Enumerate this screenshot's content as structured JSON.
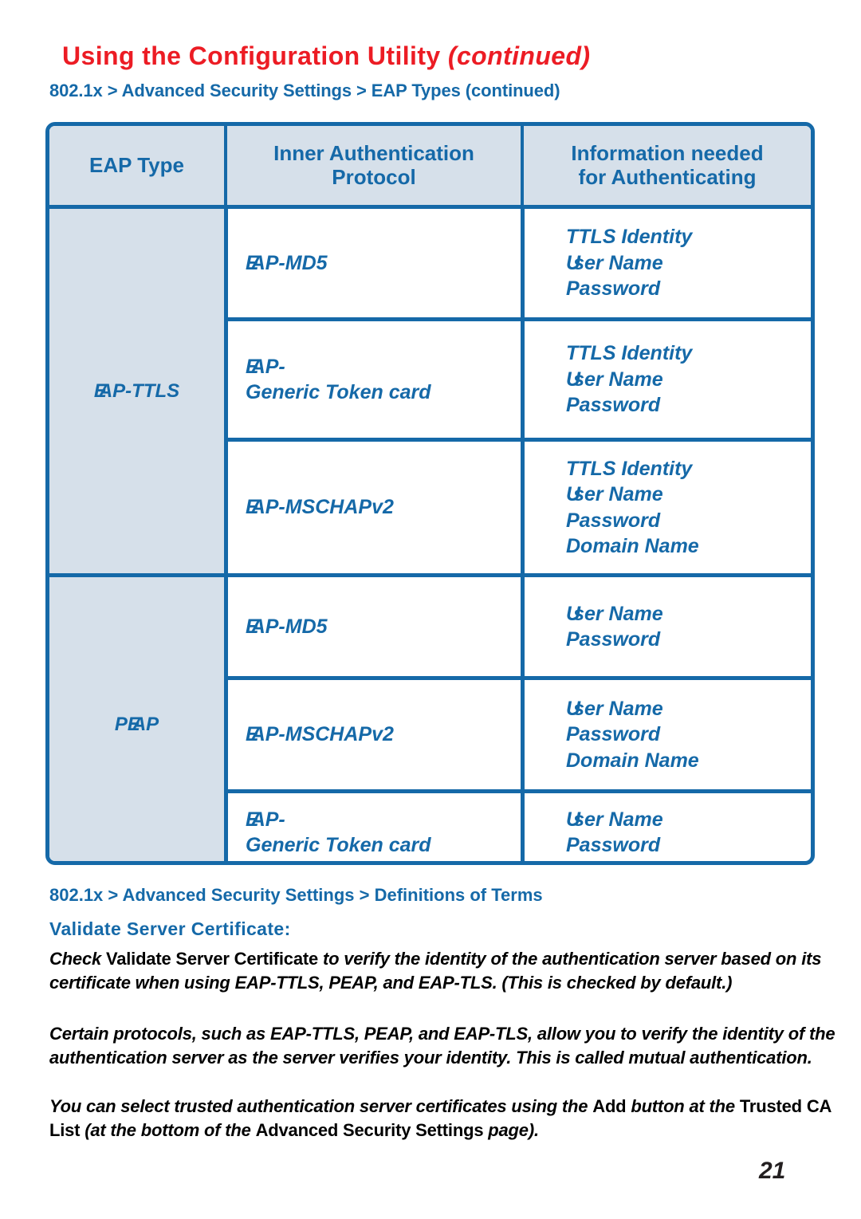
{
  "header": {
    "title_main": "Using the Configuration Utility ",
    "title_continued": "(continued)",
    "breadcrumb": "802.1x > Advanced Security Settings > EAP Types (continued)",
    "title_color": "#ec1c24",
    "accent_color": "#1569a8"
  },
  "table": {
    "columns": [
      {
        "header": "EAP Type"
      },
      {
        "header_line1": "Inner Authentication",
        "header_line2": "Protocol"
      },
      {
        "header_line1": "Information needed",
        "header_line2": "for Authenticating"
      }
    ],
    "header_fill": "#d6e0ea",
    "border_color": "#1569a8",
    "groups": [
      {
        "eap_type": "EAP-TTLS",
        "rows": [
          {
            "protocol": [
              "EAP-MD5"
            ],
            "info": [
              "TTLS Identity",
              "User Name",
              "Password"
            ]
          },
          {
            "protocol": [
              "EAP-",
              "Generic Token card"
            ],
            "info": [
              "TTLS Identity",
              "User Name",
              "Password"
            ]
          },
          {
            "protocol": [
              "EAP-MSCHAPv2"
            ],
            "info": [
              "TTLS Identity",
              "User Name",
              "Password",
              "Domain Name"
            ]
          }
        ]
      },
      {
        "eap_type": "PEAP",
        "rows": [
          {
            "protocol": [
              "EAP-MD5"
            ],
            "info": [
              "User Name",
              "Password"
            ]
          },
          {
            "protocol": [
              "EAP-MSCHAPv2"
            ],
            "info": [
              "User Name",
              "Password",
              "Domain Name"
            ]
          },
          {
            "protocol": [
              "EAP-",
              "Generic Token card"
            ],
            "info": [
              "User Name",
              "Password"
            ]
          }
        ]
      }
    ]
  },
  "definitions": {
    "breadcrumb": "802.1x > Advanced Security Settings > Definitions of Terms",
    "term_heading": "Validate Server Certificate:",
    "paragraph_1": {
      "lead_italic": "Check ",
      "upright": "Validate Server Certificate",
      "rest": " to verify the identity of the authentication server based on its certificate when using EAP-TTLS, PEAP, and EAP-TLS. (This is checked by default.)"
    },
    "paragraph_2": "Certain protocols, such as EAP-TTLS, PEAP, and EAP-TLS, allow you to verify the identity of the authentication server as the server verifies your identity. This is called mutual authentication.",
    "paragraph_3": {
      "part_1": "You can select trusted authentication server certificates using the ",
      "bold_add": "Add",
      "part_2": " button at the ",
      "upright_calist": "Trusted CA List ",
      "part_3": "(at the bottom of the ",
      "upright_advanced": "Advanced Security Settings ",
      "part_4": "page)."
    }
  },
  "footer": {
    "page_number": "21"
  }
}
